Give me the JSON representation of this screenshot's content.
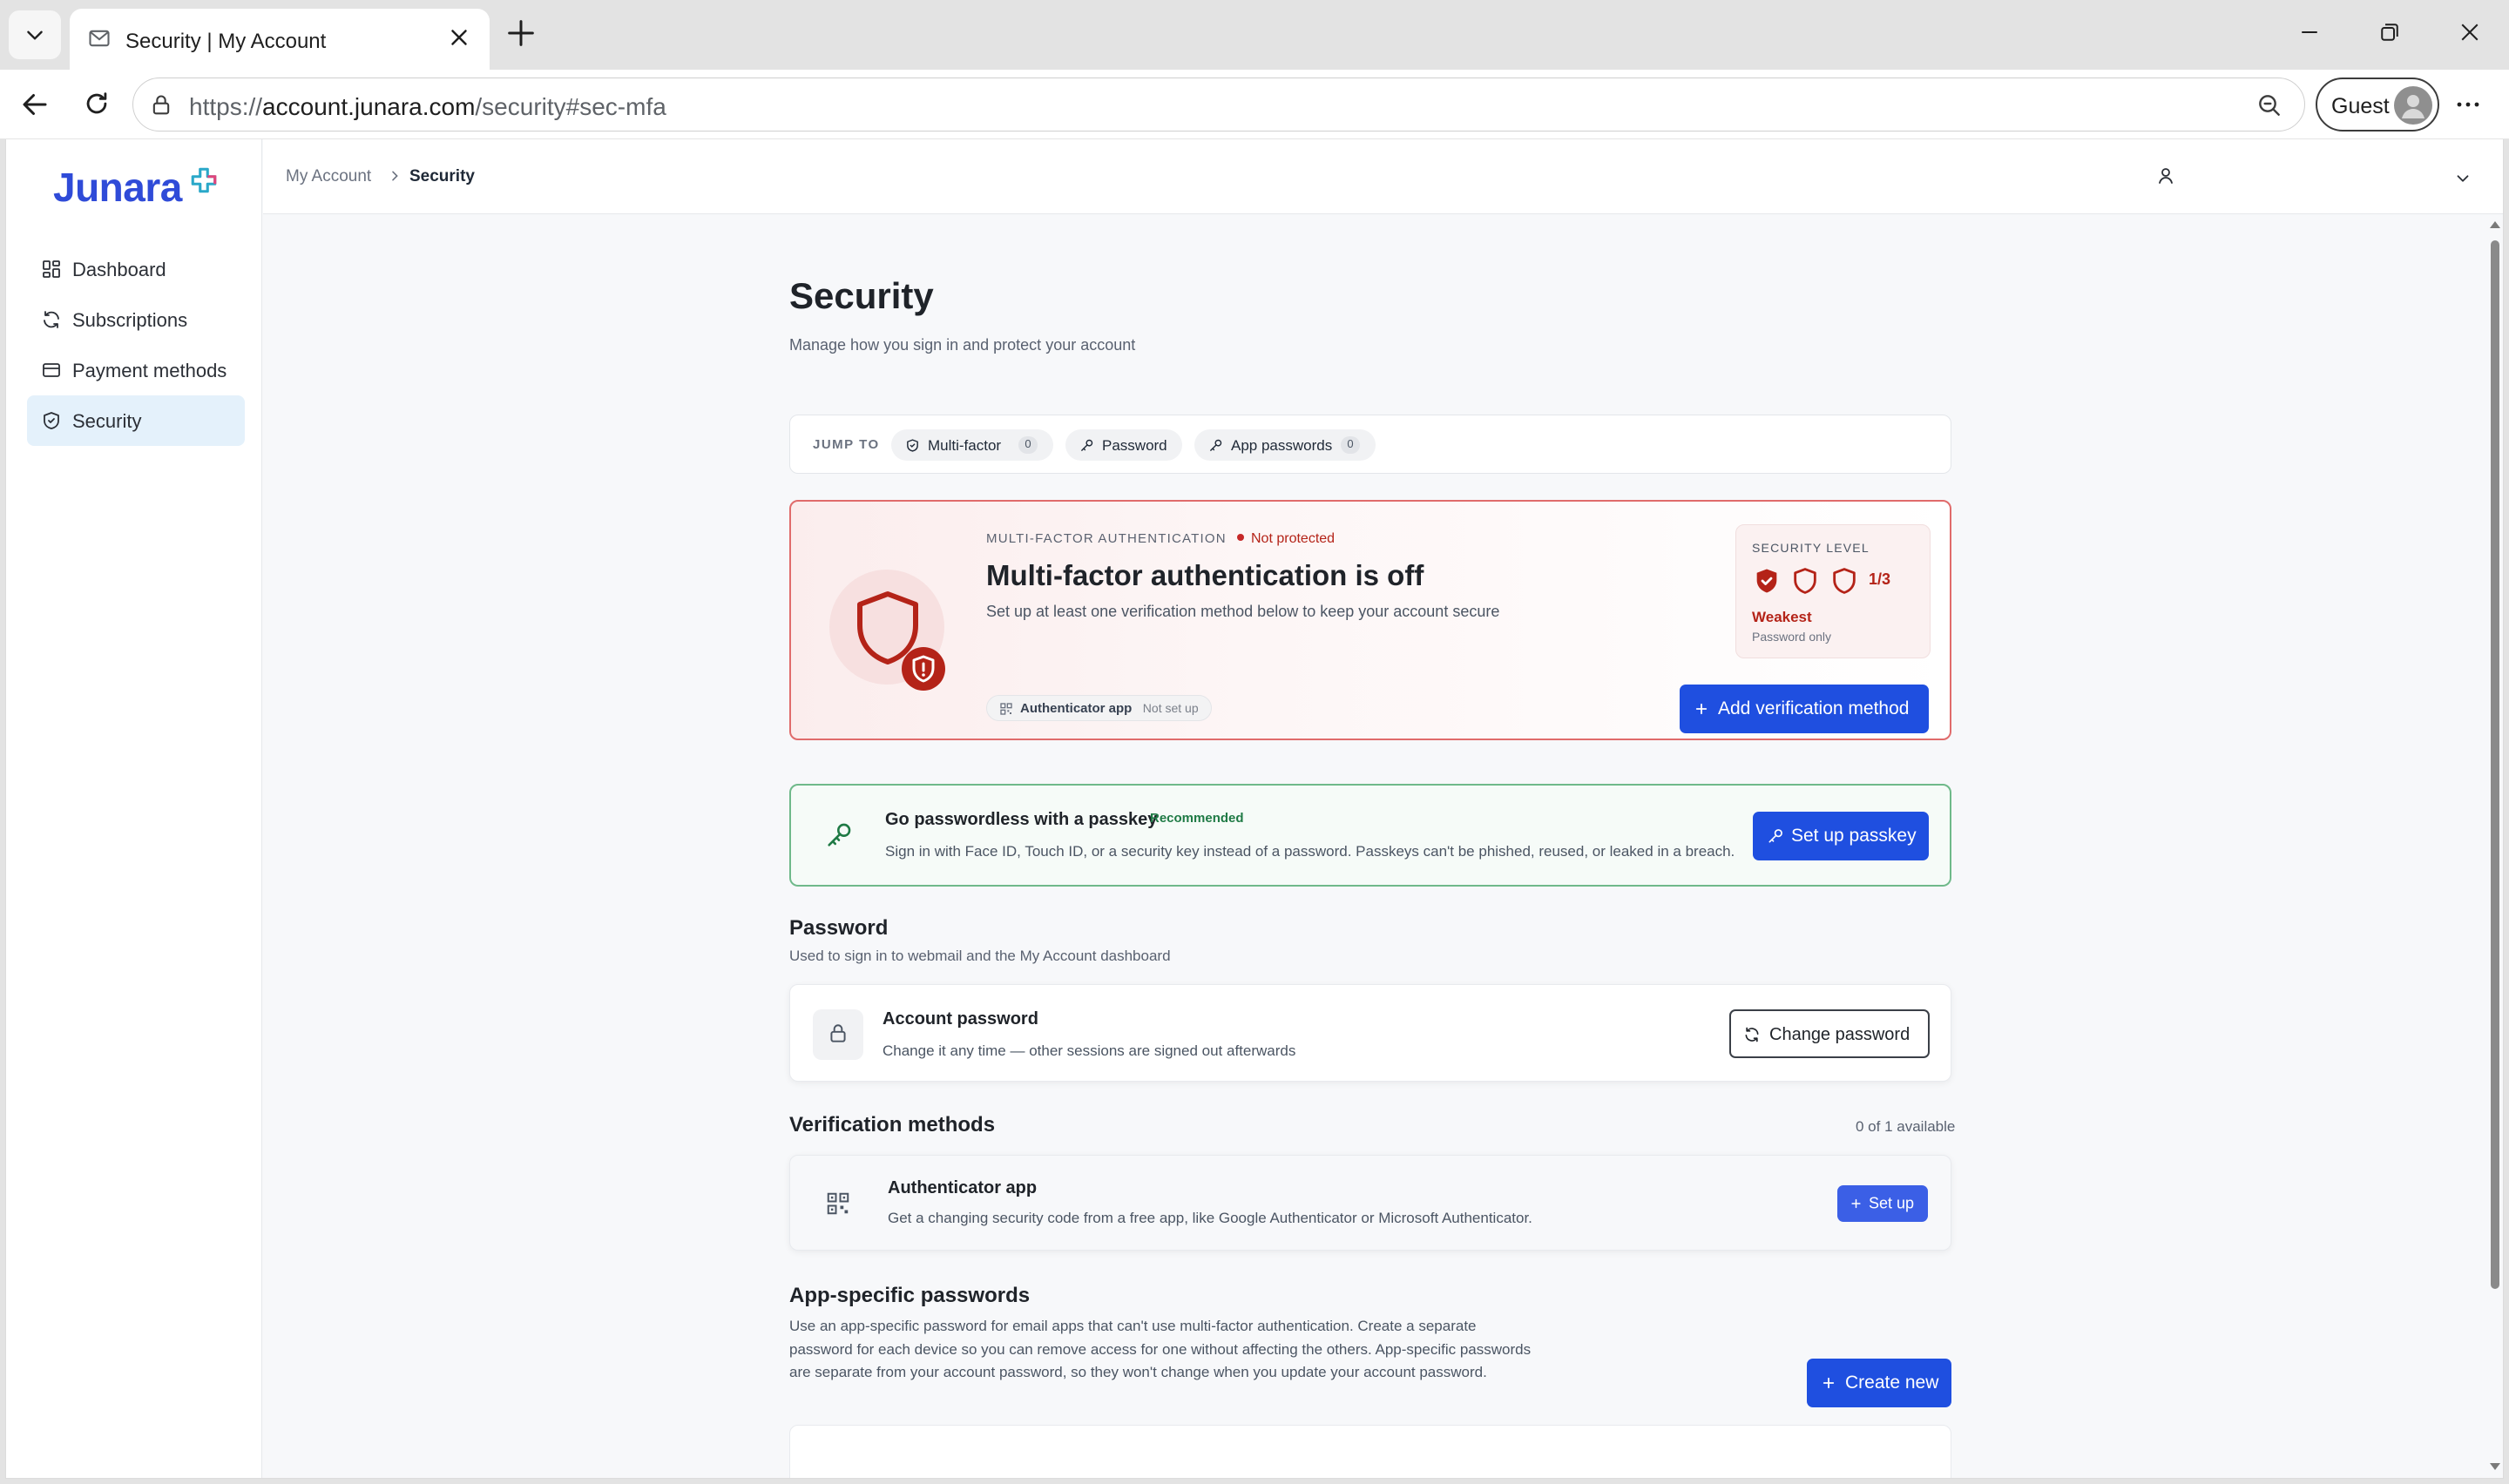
{
  "browser": {
    "tab_title": "Security | My Account",
    "url_prefix": "https://",
    "url_host": "account.junara.com",
    "url_path": "/security#sec-mfa",
    "profile_label": "Guest"
  },
  "sidebar": {
    "logo": "Junara",
    "items": [
      {
        "label": "Dashboard",
        "icon": "grid-icon"
      },
      {
        "label": "Subscriptions",
        "icon": "refresh-icon"
      },
      {
        "label": "Payment methods",
        "icon": "card-icon"
      },
      {
        "label": "Security",
        "icon": "shield-icon",
        "active": true
      }
    ]
  },
  "topbar": {
    "breadcrumb_root": "My Account",
    "breadcrumb_current": "Security"
  },
  "page": {
    "title": "Security",
    "subtitle": "Manage how you sign in and protect your account"
  },
  "jump": {
    "label": "JUMP TO",
    "chips": [
      {
        "label": "Multi-factor",
        "count": "0"
      },
      {
        "label": "Password"
      },
      {
        "label": "App passwords",
        "count": "0"
      }
    ]
  },
  "mfa": {
    "kicker": "MULTI-FACTOR AUTHENTICATION",
    "status": "Not protected",
    "title": "Multi-factor authentication is off",
    "description": "Set up at least one verification method below to keep your account secure",
    "method_tag": "Authenticator app",
    "method_state": "Not set up",
    "level_label": "SECURITY LEVEL",
    "level_ratio": "1/3",
    "level_filled": 1,
    "level_total": 3,
    "level_name": "Weakest",
    "level_note": "Password only",
    "cta": "Add verification method"
  },
  "passkey": {
    "title": "Go passwordless with a passkey",
    "badge": "Recommended",
    "description": "Sign in with Face ID, Touch ID, or a security key instead of a password. Passkeys can't be phished, reused, or leaked in a breach.",
    "cta": "Set up passkey"
  },
  "password": {
    "section_title": "Password",
    "section_sub": "Used to sign in to webmail and the My Account dashboard",
    "row_title": "Account password",
    "row_desc": "Change it any time — other sessions are signed out afterwards",
    "cta": "Change password"
  },
  "verification": {
    "section_title": "Verification methods",
    "available": "0 of 1 available",
    "row_title": "Authenticator app",
    "row_desc": "Get a changing security code from a free app, like Google Authenticator or Microsoft Authenticator.",
    "cta": "Set up"
  },
  "app_passwords": {
    "section_title": "App-specific passwords",
    "description": "Use an app-specific password for email apps that can't use multi-factor authentication. Create a separate password for each device so you can remove access for one without affecting the others. App-specific passwords are separate from your account password, so they won't change when you update your account password.",
    "cta": "Create new"
  },
  "colors": {
    "primary": "#1f4fe0",
    "danger": "#b42318",
    "success": "#1f7a45",
    "nav_active_bg": "#e4f1fb"
  }
}
